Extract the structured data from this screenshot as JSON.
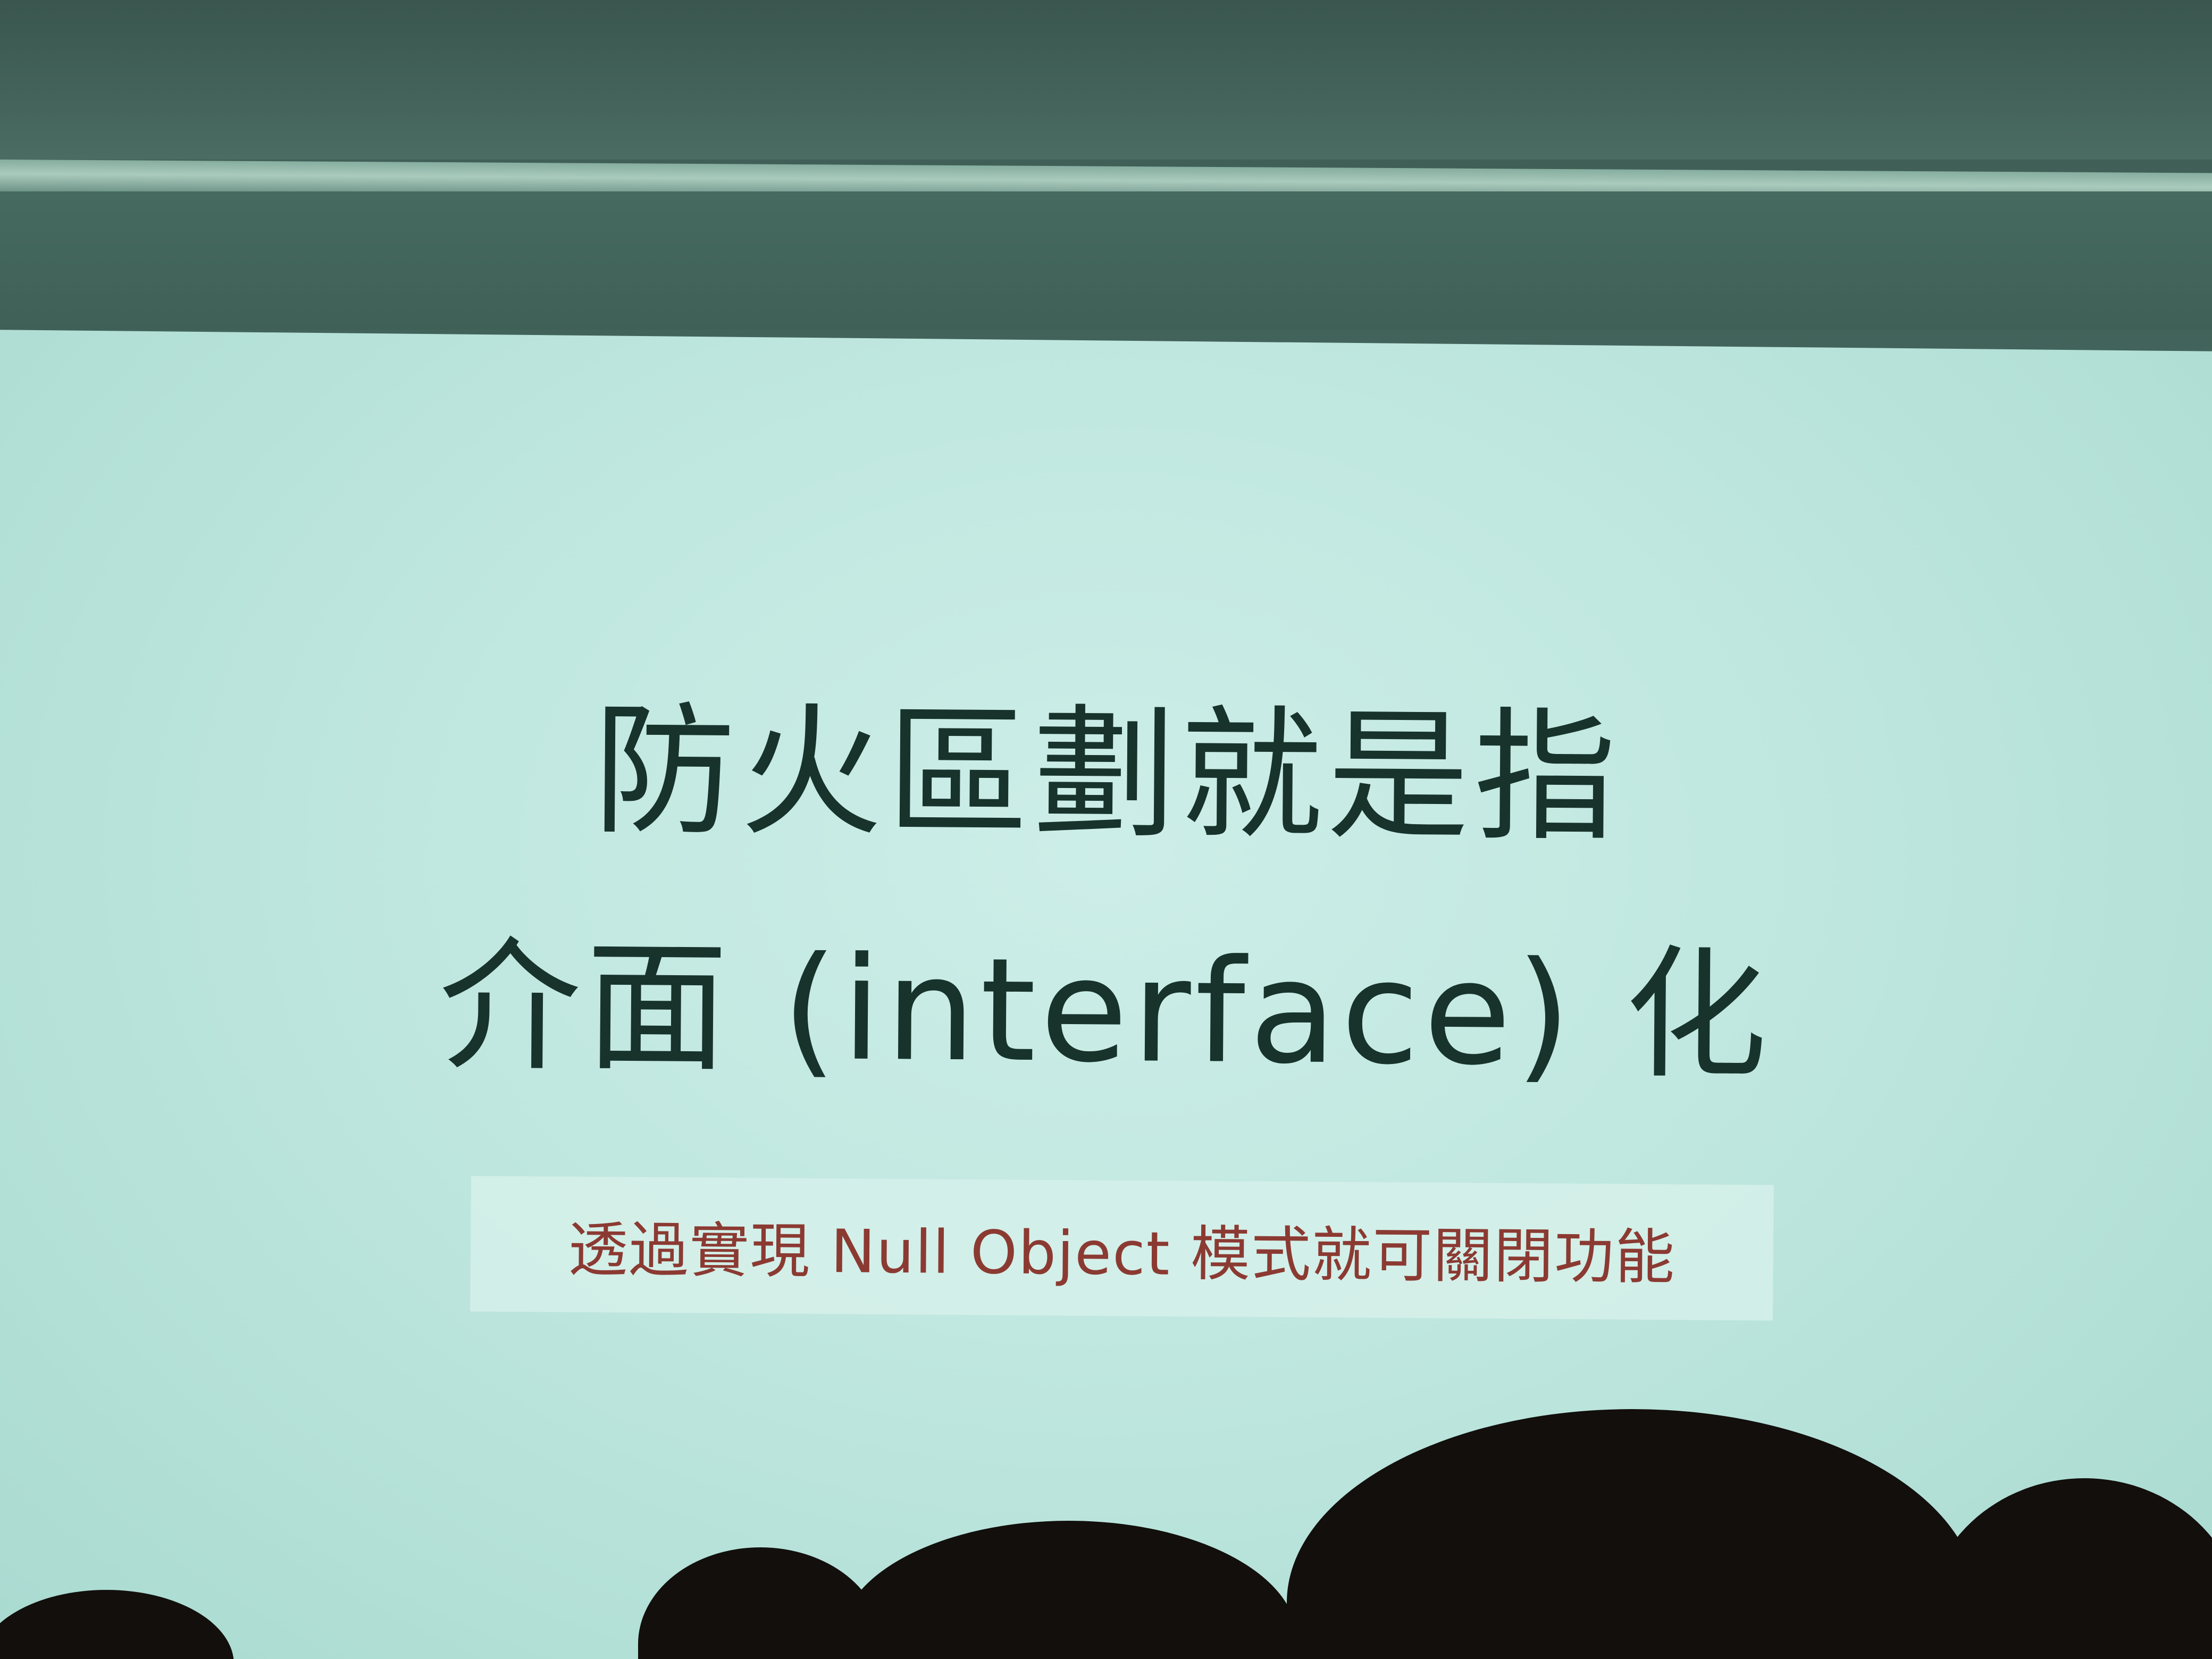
{
  "slide": {
    "title_line_1": "防火區劃就是指",
    "title_line_2": "介面 (interface) 化",
    "subtitle": "透過實現 Null Object 模式就可關閉功能"
  },
  "colors": {
    "screen": "#c3e9e1",
    "title_text": "#17332c",
    "subtitle_text": "#8b3a32",
    "wall": "#3f5d55"
  }
}
